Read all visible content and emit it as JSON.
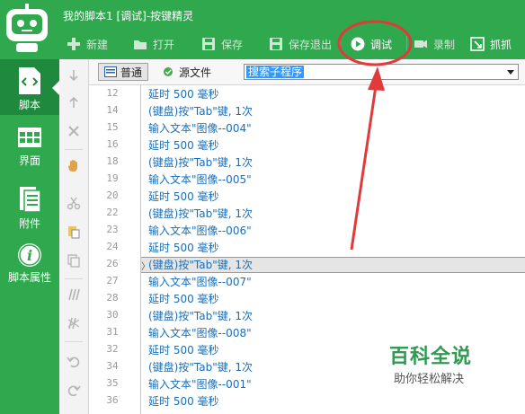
{
  "window": {
    "title": "我的脚本1 [调试]-按键精灵"
  },
  "toolbar": {
    "items": [
      {
        "label": "新建",
        "icon": "plus-icon"
      },
      {
        "label": "打开",
        "icon": "folder-icon"
      },
      {
        "label": "保存",
        "icon": "save-icon"
      },
      {
        "label": "保存退出",
        "icon": "save-exit-icon"
      },
      {
        "label": "调试",
        "icon": "play-icon"
      },
      {
        "label": "录制",
        "icon": "record-icon"
      },
      {
        "label": "抓抓",
        "icon": "grab-icon"
      }
    ],
    "accent": "#e03a3a"
  },
  "nav": {
    "items": [
      {
        "label": "脚本",
        "icon": "script-icon"
      },
      {
        "label": "界面",
        "icon": "interface-icon"
      },
      {
        "label": "附件",
        "icon": "attachment-icon"
      },
      {
        "label": "脚本属性",
        "icon": "info-icon"
      }
    ]
  },
  "tabs": [
    {
      "label": "普通"
    },
    {
      "label": "源文件"
    }
  ],
  "search": {
    "value": "搜索子程序"
  },
  "code": {
    "lines": [
      {
        "num": "12",
        "text": "延时 500 毫秒"
      },
      {
        "num": "14",
        "text": "(键盘)按\"Tab\"键, 1次"
      },
      {
        "num": "15",
        "text": "输入文本\"图像--004\""
      },
      {
        "num": "16",
        "text": "延时 500 毫秒"
      },
      {
        "num": "18",
        "text": "(键盘)按\"Tab\"键, 1次"
      },
      {
        "num": "19",
        "text": "输入文本\"图像--005\""
      },
      {
        "num": "20",
        "text": "延时 500 毫秒"
      },
      {
        "num": "22",
        "text": "(键盘)按\"Tab\"键, 1次"
      },
      {
        "num": "23",
        "text": "输入文本\"图像--006\""
      },
      {
        "num": "24",
        "text": "延时 500 毫秒"
      },
      {
        "num": "26",
        "text": "(键盘)按\"Tab\"键, 1次"
      },
      {
        "num": "27",
        "text": "输入文本\"图像--007\""
      },
      {
        "num": "28",
        "text": "延时 500 毫秒"
      },
      {
        "num": "30",
        "text": "(键盘)按\"Tab\"键, 1次"
      },
      {
        "num": "31",
        "text": "输入文本\"图像--008\""
      },
      {
        "num": "32",
        "text": "延时 500 毫秒"
      },
      {
        "num": "34",
        "text": "(键盘)按\"Tab\"键, 1次"
      },
      {
        "num": "35",
        "text": "输入文本\"图像--001\""
      },
      {
        "num": "36",
        "text": "延时 500 毫秒"
      }
    ],
    "highlighted_line": "26",
    "text_color": "#1a6fb8"
  },
  "watermark": {
    "title": "百科全说",
    "subtitle": "助你轻松解决"
  },
  "colors": {
    "brand_green": "#2fa84e",
    "nav_selected": "#1f8a3d"
  }
}
